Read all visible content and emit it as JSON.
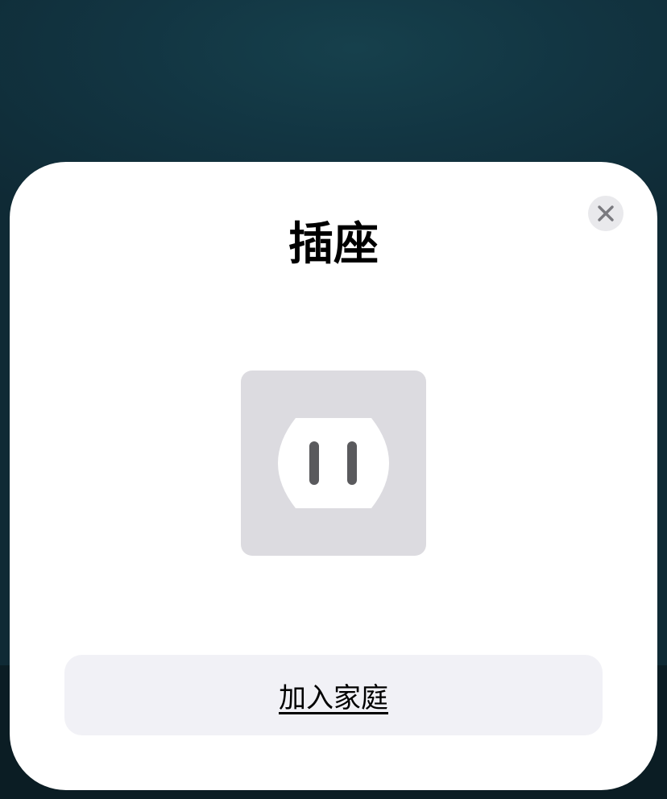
{
  "dialog": {
    "title": "插座",
    "accessory_icon": "power-outlet-icon",
    "close_icon": "close-icon",
    "primary_button_label": "加入家庭"
  },
  "colors": {
    "background": "#123542",
    "card": "#ffffff",
    "tile": "#dcdbe0",
    "button": "#f1f1f6",
    "icon_slots": "#5a5a5d"
  }
}
